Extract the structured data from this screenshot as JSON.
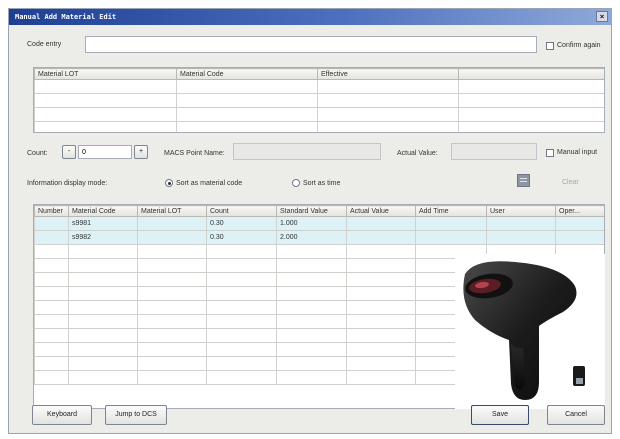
{
  "window": {
    "title": "Manual Add Material Edit",
    "close_glyph": "×"
  },
  "code_entry": {
    "label": "Code entry",
    "value": "",
    "confirm_again_label": "Confirm again"
  },
  "top_table": {
    "columns": [
      "Material LOT",
      "Material Code",
      "Effective",
      ""
    ],
    "rows": [
      [
        "",
        "",
        "",
        ""
      ],
      [
        "",
        "",
        "",
        ""
      ],
      [
        "",
        "",
        "",
        ""
      ],
      [
        "",
        "",
        "",
        ""
      ]
    ]
  },
  "count": {
    "label": "Count:",
    "minus": "-",
    "value": "0",
    "plus": "+"
  },
  "macs": {
    "label": "MACS Point Name:",
    "value": ""
  },
  "actual": {
    "label": "Actual Value:",
    "value": ""
  },
  "manual_input_label": "Manual input",
  "display_mode": {
    "label": "Information display mode:",
    "options": [
      "Sort as material code",
      "Sort as time"
    ],
    "selected": "Sort as material code"
  },
  "clear_label": "Clear",
  "main_table": {
    "columns": [
      "Number",
      "Material Code",
      "Material LOT",
      "Count",
      "Standard Value",
      "Actual Value",
      "Add Time",
      "User",
      "Oper..."
    ],
    "rows": [
      [
        "",
        "s9981",
        "",
        "0.30",
        "1.000",
        "",
        "",
        "",
        ""
      ],
      [
        "",
        "s9982",
        "",
        "0.30",
        "2.000",
        "",
        "",
        "",
        ""
      ]
    ],
    "empty_rows": 10
  },
  "footer": {
    "keyboard": "Keyboard",
    "jump": "Jump to DCS",
    "save": "Save",
    "cancel": "Cancel"
  },
  "overlay": {
    "icon": "barcode-scanner-icon"
  }
}
